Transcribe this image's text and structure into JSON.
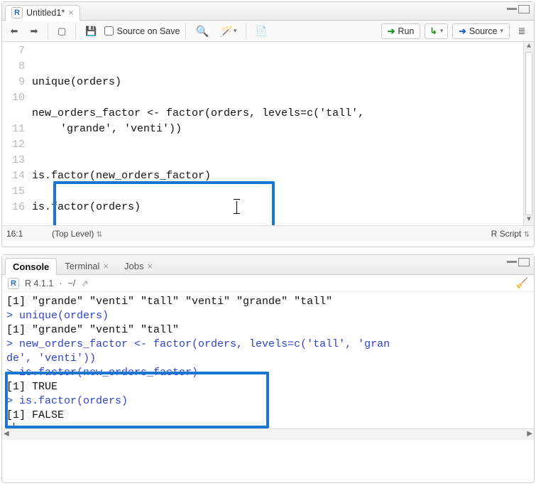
{
  "source": {
    "tab_title": "Untitled1*",
    "toolbar": {
      "source_on_save": "Source on Save",
      "run": "Run",
      "source": "Source"
    },
    "lines": {
      "start": 7,
      "l8": "unique(orders)",
      "l10": "new_orders_factor <- factor(orders, levels=c('tall',",
      "l10b": "'grande', 'venti'))",
      "l12": "is.factor(new_orders_factor)",
      "l14": "is.factor(orders)"
    },
    "status": {
      "cursor": "16:1",
      "scope": "(Top Level)",
      "mode": "R Script"
    }
  },
  "console": {
    "tabs": {
      "console": "Console",
      "terminal": "Terminal",
      "jobs": "Jobs"
    },
    "header": {
      "version": "R 4.1.1",
      "path": "~/"
    },
    "lines": {
      "o1": "[1] \"grande\" \"venti\"  \"tall\"   \"venti\"  \"grande\" \"tall\"",
      "c1": "> unique(orders)",
      "o2": "[1] \"grande\" \"venti\"  \"tall\"",
      "c2": "> new_orders_factor <- factor(orders, levels=c('tall', 'gran",
      "c2b": "de', 'venti'))",
      "c3": "> is.factor(new_orders_factor)",
      "o3": "[1] TRUE",
      "c4": "> is.factor(orders)",
      "o4": "[1] FALSE",
      "p": ">"
    }
  }
}
